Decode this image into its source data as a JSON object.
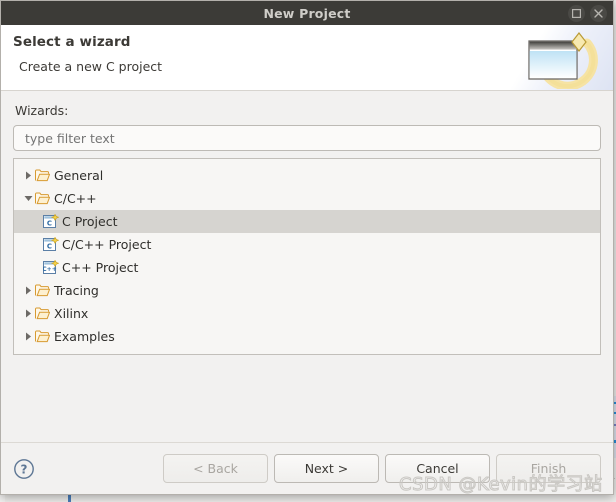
{
  "window": {
    "title": "New Project",
    "buttons": [
      {
        "name": "maximize-button",
        "glyph": "maximize-icon"
      },
      {
        "name": "close-button",
        "glyph": "close-icon"
      }
    ]
  },
  "banner": {
    "heading": "Select a wizard",
    "subtext": "Create a new C project",
    "icon": "new-project-wizard-icon"
  },
  "form": {
    "wizards_label": "Wizards:",
    "filter": {
      "value": "",
      "placeholder": "type filter text"
    }
  },
  "tree": {
    "items": [
      {
        "label": "General",
        "icon": "folder-icon",
        "level": 0,
        "expander": "collapsed",
        "selected": false
      },
      {
        "label": "C/C++",
        "icon": "folder-icon",
        "level": 0,
        "expander": "expanded",
        "selected": false
      },
      {
        "label": "C Project",
        "icon": "c-project-icon",
        "level": 1,
        "expander": "none",
        "selected": true
      },
      {
        "label": "C/C++ Project",
        "icon": "c-project-icon",
        "level": 1,
        "expander": "none",
        "selected": false
      },
      {
        "label": "C++ Project",
        "icon": "cpp-project-icon",
        "level": 1,
        "expander": "none",
        "selected": false
      },
      {
        "label": "Tracing",
        "icon": "folder-icon",
        "level": 0,
        "expander": "collapsed",
        "selected": false
      },
      {
        "label": "Xilinx",
        "icon": "folder-icon",
        "level": 0,
        "expander": "collapsed",
        "selected": false
      },
      {
        "label": "Examples",
        "icon": "folder-icon",
        "level": 0,
        "expander": "collapsed",
        "selected": false
      }
    ]
  },
  "footer": {
    "help": "help-icon",
    "back_label": "< Back",
    "next_label": "Next >",
    "cancel_label": "Cancel",
    "finish_label": "Finish"
  },
  "watermark": {
    "text": "CSDN @Kevin的学习站"
  },
  "colors": {
    "titlebar": "#3c3b37",
    "dialog_bg": "#f2f1f0",
    "banner_bg": "#ffffff",
    "selection": "#d6d4d0",
    "folder": "#e9a93b",
    "accent_blue": "#2b8fd8"
  }
}
